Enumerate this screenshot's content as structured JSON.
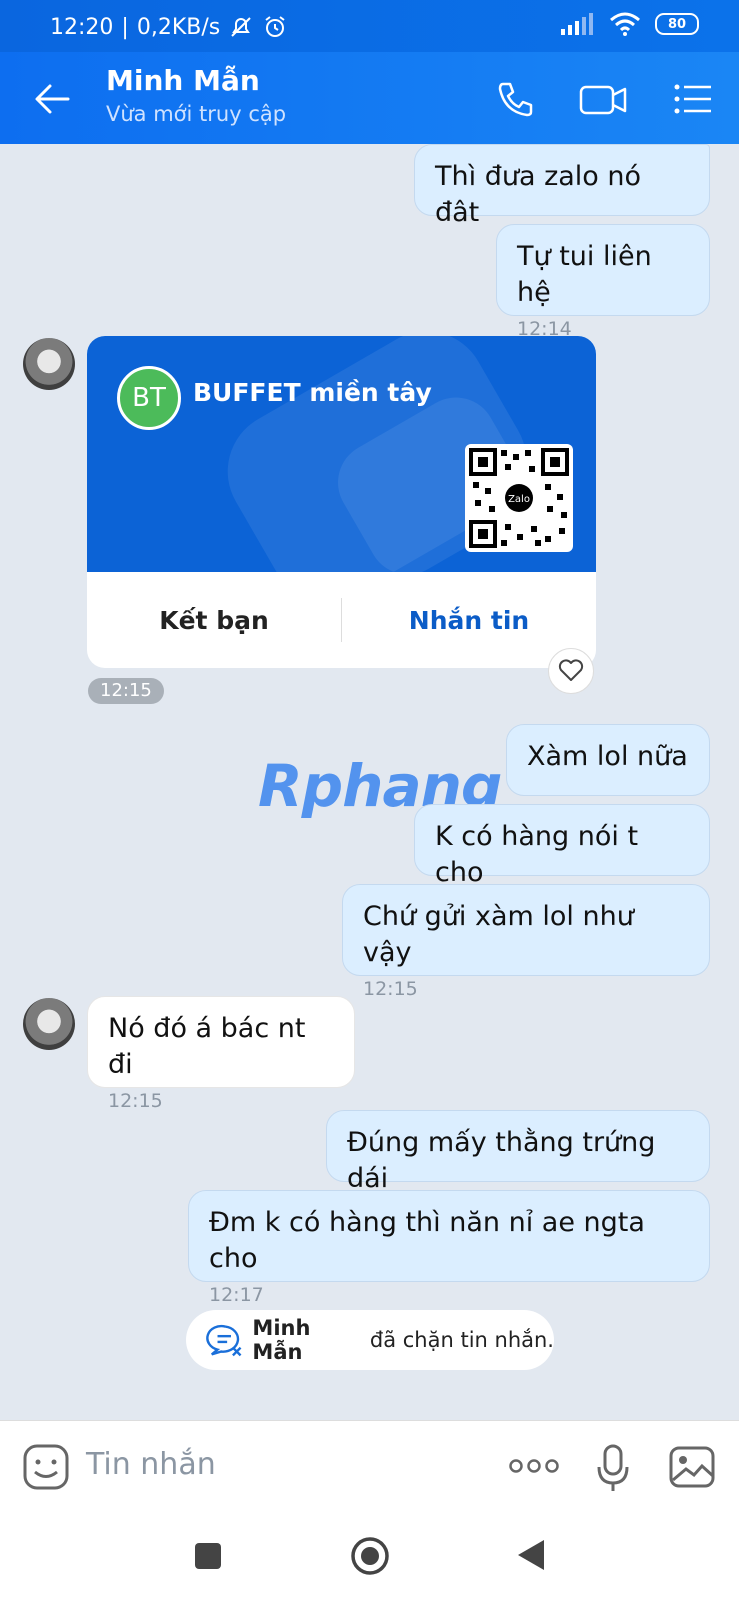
{
  "status_bar": {
    "time": "12:20",
    "speed": "0,2KB/s",
    "battery": "80"
  },
  "header": {
    "name": "Minh Mẫn",
    "status": "Vừa mới truy cập"
  },
  "messages": {
    "m1": {
      "text": "Thì đưa zalo nó đât"
    },
    "m2": {
      "text": "Tự tui liên hệ",
      "time": "12:14"
    },
    "card": {
      "avatar_initials": "BT",
      "title": "BUFFET miền tây",
      "qr_label": "Zalo",
      "add_friend": "Kết bạn",
      "message": "Nhắn tin",
      "time": "12:15"
    },
    "m3": {
      "text": "Xàm lol nữa"
    },
    "m4": {
      "text": "K có hàng nói t cho"
    },
    "m5": {
      "text": "Chứ gửi xàm lol như vậy",
      "time": "12:15"
    },
    "m6": {
      "text": "Nó đó á bác nt đi",
      "time": "12:15"
    },
    "m7": {
      "text": "Đúng mấy thằng trứng dái"
    },
    "m8": {
      "text": "Đm k có hàng thì năn nỉ ae ngta cho",
      "time": "12:17"
    }
  },
  "watermark": "Rphang",
  "blocked_notice": {
    "name": "Minh Mẫn",
    "text": " đã chặn tin nhắn."
  },
  "input": {
    "placeholder": "Tin nhắn"
  },
  "colors": {
    "header": "#1a86f5",
    "sent_bubble": "#dbeeff",
    "card": "#0c63d6"
  }
}
